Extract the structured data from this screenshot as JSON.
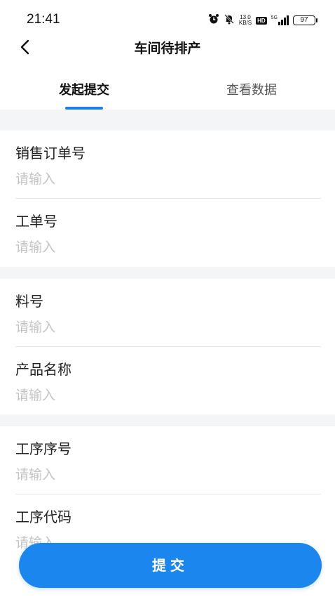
{
  "status_bar": {
    "time": "21:41",
    "net_speed_value": "13.0",
    "net_speed_unit": "KB/S",
    "hd_label": "HD",
    "network": "5G",
    "battery": "97"
  },
  "header": {
    "title": "车间待排产"
  },
  "tabs": [
    {
      "label": "发起提交",
      "active": true
    },
    {
      "label": "查看数据",
      "active": false
    }
  ],
  "form": {
    "fields": [
      {
        "label": "销售订单号",
        "placeholder": "请输入",
        "value": ""
      },
      {
        "label": "工单号",
        "placeholder": "请输入",
        "value": ""
      },
      {
        "label": "料号",
        "placeholder": "请输入",
        "value": ""
      },
      {
        "label": "产品名称",
        "placeholder": "请输入",
        "value": ""
      },
      {
        "label": "工序序号",
        "placeholder": "请输入",
        "value": ""
      },
      {
        "label": "工序代码",
        "placeholder": "请输入",
        "value": ""
      }
    ]
  },
  "actions": {
    "submit_label": "提交"
  },
  "colors": {
    "accent": "#1e7de8",
    "button": "#1b86ee",
    "section_gap": "#f4f5f7",
    "placeholder": "#c4c4c4"
  }
}
